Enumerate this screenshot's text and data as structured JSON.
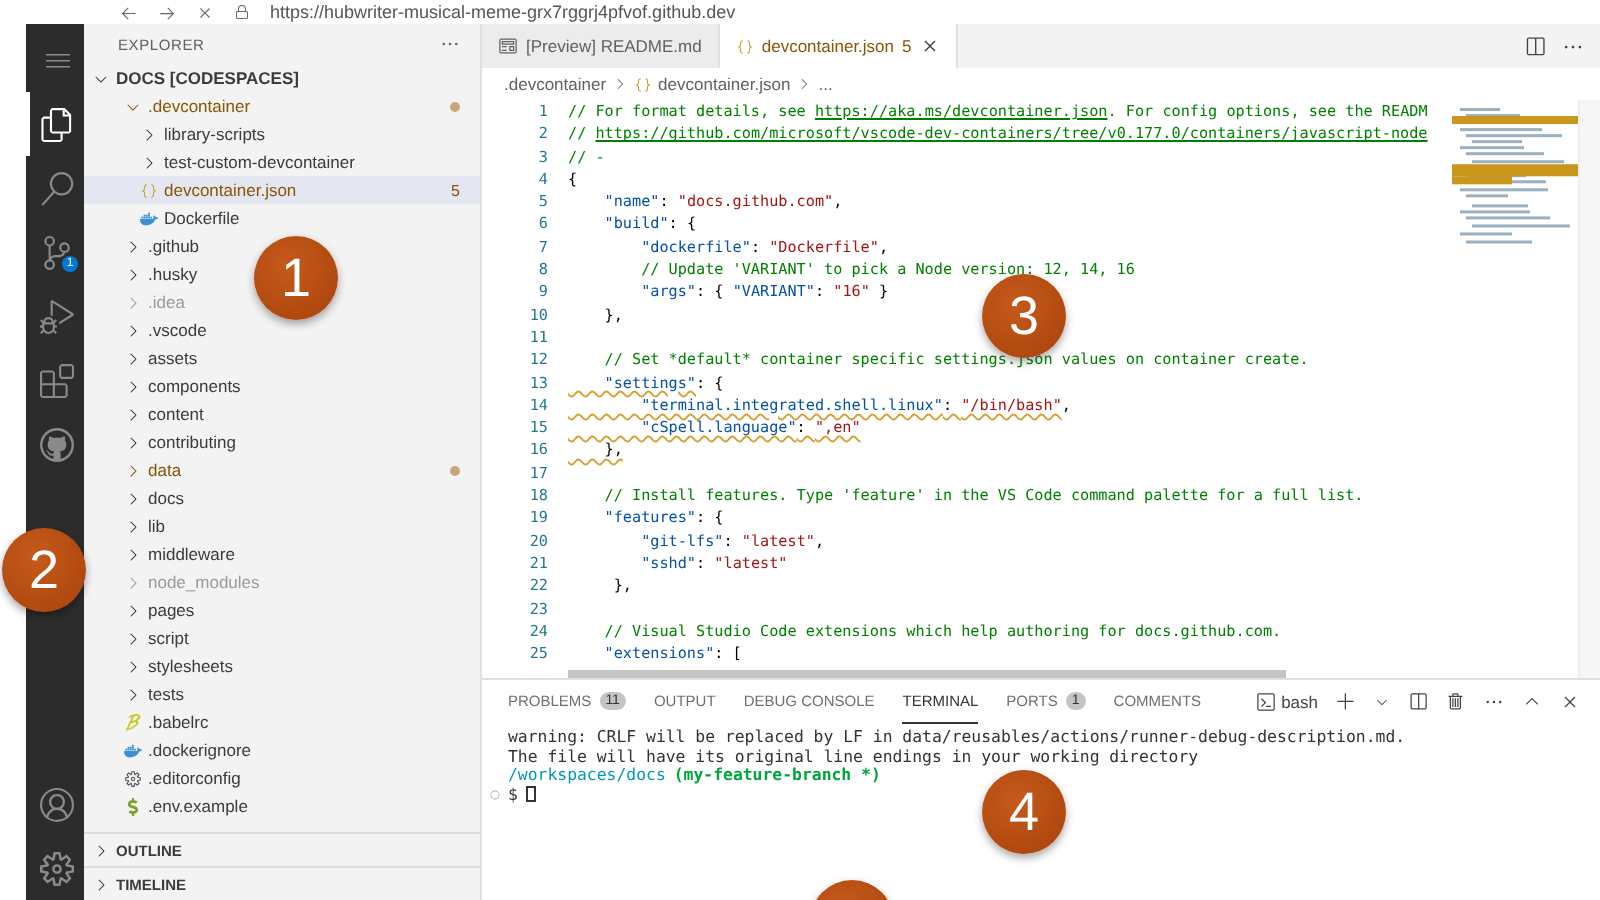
{
  "browser": {
    "url": "https://hubwriter-musical-meme-grx7rggrj4pfvof.github.dev"
  },
  "activity_bar": {
    "items": [
      {
        "selected": true
      },
      {
        "selected": false
      },
      {
        "selected": false,
        "badge": "1"
      },
      {
        "selected": false
      },
      {
        "selected": false
      },
      {
        "selected": false
      }
    ]
  },
  "sidebar": {
    "title": "EXPLORER",
    "sections": [
      {
        "label": "OUTLINE"
      },
      {
        "label": "TIMELINE"
      }
    ],
    "tree": {
      "label": "DOCS [CODESPACES]",
      "expanded": true,
      "children": [
        {
          "label": ".devcontainer",
          "kind": "folder",
          "expanded": true,
          "selected": false,
          "modified": true,
          "dimmed": false,
          "children": [
            {
              "label": "library-scripts",
              "kind": "folder",
              "expanded": false,
              "selected": false,
              "modified": false,
              "dimmed": false
            },
            {
              "label": "test-custom-devcontainer",
              "kind": "folder",
              "expanded": false,
              "selected": false,
              "modified": false,
              "dimmed": false
            },
            {
              "label": "devcontainer.json",
              "kind": "json",
              "selected": true,
              "modified": true,
              "dimmed": false,
              "badge": "5"
            },
            {
              "label": "Dockerfile",
              "kind": "docker",
              "selected": false,
              "modified": false,
              "dimmed": false
            }
          ]
        },
        {
          "label": ".github",
          "kind": "folder",
          "expanded": false,
          "selected": false,
          "modified": false,
          "dimmed": false
        },
        {
          "label": ".husky",
          "kind": "folder",
          "expanded": false,
          "selected": false,
          "modified": false,
          "dimmed": false
        },
        {
          "label": ".idea",
          "kind": "folder",
          "expanded": false,
          "selected": false,
          "modified": false,
          "dimmed": true
        },
        {
          "label": ".vscode",
          "kind": "folder",
          "expanded": false,
          "selected": false,
          "modified": false,
          "dimmed": false
        },
        {
          "label": "assets",
          "kind": "folder",
          "expanded": false,
          "selected": false,
          "modified": false,
          "dimmed": false
        },
        {
          "label": "components",
          "kind": "folder",
          "expanded": false,
          "selected": false,
          "modified": false,
          "dimmed": false
        },
        {
          "label": "content",
          "kind": "folder",
          "expanded": false,
          "selected": false,
          "modified": false,
          "dimmed": false
        },
        {
          "label": "contributing",
          "kind": "folder",
          "expanded": false,
          "selected": false,
          "modified": false,
          "dimmed": false
        },
        {
          "label": "data",
          "kind": "folder",
          "expanded": false,
          "selected": false,
          "modified": true,
          "dimmed": false
        },
        {
          "label": "docs",
          "kind": "folder",
          "expanded": false,
          "selected": false,
          "modified": false,
          "dimmed": false
        },
        {
          "label": "lib",
          "kind": "folder",
          "expanded": false,
          "selected": false,
          "modified": false,
          "dimmed": false
        },
        {
          "label": "middleware",
          "kind": "folder",
          "expanded": false,
          "selected": false,
          "modified": false,
          "dimmed": false
        },
        {
          "label": "node_modules",
          "kind": "folder",
          "expanded": false,
          "selected": false,
          "modified": false,
          "dimmed": true
        },
        {
          "label": "pages",
          "kind": "folder",
          "expanded": false,
          "selected": false,
          "modified": false,
          "dimmed": false
        },
        {
          "label": "script",
          "kind": "folder",
          "expanded": false,
          "selected": false,
          "modified": false,
          "dimmed": false
        },
        {
          "label": "stylesheets",
          "kind": "folder",
          "expanded": false,
          "selected": false,
          "modified": false,
          "dimmed": false
        },
        {
          "label": "tests",
          "kind": "folder",
          "expanded": false,
          "selected": false,
          "modified": false,
          "dimmed": false
        },
        {
          "label": ".babelrc",
          "kind": "babel",
          "selected": false,
          "modified": false,
          "dimmed": false
        },
        {
          "label": ".dockerignore",
          "kind": "docker",
          "selected": false,
          "modified": false,
          "dimmed": false
        },
        {
          "label": ".editorconfig",
          "kind": "config",
          "selected": false,
          "modified": false,
          "dimmed": false
        },
        {
          "label": ".env.example",
          "kind": "env",
          "selected": false,
          "modified": false,
          "dimmed": false
        }
      ]
    }
  },
  "editor": {
    "tabs": [
      {
        "label": "[Preview] README.md",
        "kind": "preview",
        "selected": false
      },
      {
        "label": "devcontainer.json",
        "kind": "json",
        "selected": true,
        "badge": "5"
      }
    ],
    "breadcrumb": [
      {
        "label": ".devcontainer",
        "kind": "folder"
      },
      {
        "label": "devcontainer.json",
        "kind": "json"
      },
      {
        "label": "...",
        "kind": "more"
      }
    ],
    "lines": [
      {
        "number": "1",
        "tokens": [
          {
            "kind": "comment",
            "text": "// For format details, see "
          },
          {
            "kind": "link",
            "text": "https://aka.ms/devcontainer.json"
          },
          {
            "kind": "comment",
            "text": ". For config options, see the READM"
          }
        ]
      },
      {
        "number": "2",
        "tokens": [
          {
            "kind": "comment",
            "text": "// "
          },
          {
            "kind": "link",
            "text": "https://github.com/microsoft/vscode-dev-containers/tree/v0.177.0/containers/javascript-node"
          }
        ]
      },
      {
        "number": "3",
        "tokens": [
          {
            "kind": "comment",
            "text": "// -"
          }
        ]
      },
      {
        "number": "4",
        "tokens": [
          {
            "kind": "punct",
            "text": "{"
          }
        ]
      },
      {
        "number": "5",
        "tokens": [
          {
            "kind": "key",
            "text": "    \"name\""
          },
          {
            "kind": "punct",
            "text": ": "
          },
          {
            "kind": "string",
            "text": "\"docs.github.com\""
          },
          {
            "kind": "punct",
            "text": ","
          }
        ]
      },
      {
        "number": "6",
        "tokens": [
          {
            "kind": "key",
            "text": "    \"build\""
          },
          {
            "kind": "punct",
            "text": ": {"
          }
        ]
      },
      {
        "number": "7",
        "tokens": [
          {
            "kind": "key",
            "text": "        \"dockerfile\""
          },
          {
            "kind": "punct",
            "text": ": "
          },
          {
            "kind": "string",
            "text": "\"Dockerfile\""
          },
          {
            "kind": "punct",
            "text": ","
          }
        ]
      },
      {
        "number": "8",
        "tokens": [
          {
            "kind": "comment",
            "text": "        // Update 'VARIANT' to pick a Node version: 12, 14, 16"
          }
        ]
      },
      {
        "number": "9",
        "tokens": [
          {
            "kind": "key",
            "text": "        \"args\""
          },
          {
            "kind": "punct",
            "text": ": { "
          },
          {
            "kind": "key",
            "text": "\"VARIANT\""
          },
          {
            "kind": "punct",
            "text": ": "
          },
          {
            "kind": "string",
            "text": "\"16\""
          },
          {
            "kind": "punct",
            "text": " }"
          }
        ]
      },
      {
        "number": "10",
        "tokens": [
          {
            "kind": "punct",
            "text": "    },"
          }
        ]
      },
      {
        "number": "11"
      },
      {
        "number": "12",
        "tokens": [
          {
            "kind": "comment",
            "text": "    // Set *default* container specific settings.json values on container create."
          }
        ]
      },
      {
        "number": "13",
        "tokens": [
          {
            "kind": "key",
            "text": "    \"settings\"",
            "warn": true
          },
          {
            "kind": "punct",
            "text": ": {"
          }
        ]
      },
      {
        "number": "14",
        "tokens": [
          {
            "kind": "key",
            "text": "        \"terminal.integrated.shell.linux\"",
            "warn": true
          },
          {
            "kind": "punct",
            "text": ": ",
            "warn": true
          },
          {
            "kind": "string",
            "text": "\"/bin/bash\"",
            "warn": true
          },
          {
            "kind": "punct",
            "text": ","
          }
        ]
      },
      {
        "number": "15",
        "tokens": [
          {
            "kind": "key",
            "text": "        \"cSpell.language\"",
            "warn": true
          },
          {
            "kind": "punct",
            "text": ": ",
            "warn": true
          },
          {
            "kind": "string",
            "text": "\",en\"",
            "warn": true
          }
        ]
      },
      {
        "number": "16",
        "tokens": [
          {
            "kind": "punct",
            "text": "    },",
            "warn": true
          }
        ]
      },
      {
        "number": "17"
      },
      {
        "number": "18",
        "tokens": [
          {
            "kind": "comment",
            "text": "    // Install features. Type 'feature' in the VS Code command palette for a full list."
          }
        ]
      },
      {
        "number": "19",
        "tokens": [
          {
            "kind": "key",
            "text": "    \"features\""
          },
          {
            "kind": "punct",
            "text": ": {"
          }
        ]
      },
      {
        "number": "20",
        "tokens": [
          {
            "kind": "key",
            "text": "        \"git-lfs\""
          },
          {
            "kind": "punct",
            "text": ": "
          },
          {
            "kind": "string",
            "text": "\"latest\""
          },
          {
            "kind": "punct",
            "text": ","
          }
        ]
      },
      {
        "number": "21",
        "tokens": [
          {
            "kind": "key",
            "text": "        \"sshd\""
          },
          {
            "kind": "punct",
            "text": ": "
          },
          {
            "kind": "string",
            "text": "\"latest\""
          }
        ]
      },
      {
        "number": "22",
        "tokens": [
          {
            "kind": "punct",
            "text": "     },"
          }
        ]
      },
      {
        "number": "23"
      },
      {
        "number": "24",
        "tokens": [
          {
            "kind": "comment",
            "text": "    // Visual Studio Code extensions which help authoring for docs.github.com."
          }
        ]
      },
      {
        "number": "25",
        "tokens": [
          {
            "kind": "key",
            "text": "    \"extensions\""
          },
          {
            "kind": "punct",
            "text": ": ["
          }
        ]
      }
    ]
  },
  "panel": {
    "tabs": [
      {
        "label": "PROBLEMS",
        "badge": "11",
        "selected": false
      },
      {
        "label": "OUTPUT",
        "selected": false
      },
      {
        "label": "DEBUG CONSOLE",
        "selected": false
      },
      {
        "label": "TERMINAL",
        "selected": true
      },
      {
        "label": "PORTS",
        "badge": "1",
        "selected": false
      },
      {
        "label": "COMMENTS",
        "selected": false
      }
    ],
    "shell": "bash",
    "terminal": [
      {
        "kind": "output",
        "text": "warning: CRLF will be replaced by LF in data/reusables/actions/runner-debug-description.md."
      },
      {
        "kind": "output",
        "text": "The file will have its original line endings in your working directory"
      },
      {
        "kind": "prompt",
        "path": "/workspaces/docs",
        "branch": "(my-feature-branch *)"
      },
      {
        "kind": "input",
        "prompt": "$"
      }
    ]
  },
  "callouts": [
    {
      "label": "1"
    },
    {
      "label": "2"
    },
    {
      "label": "3"
    },
    {
      "label": "4"
    }
  ]
}
